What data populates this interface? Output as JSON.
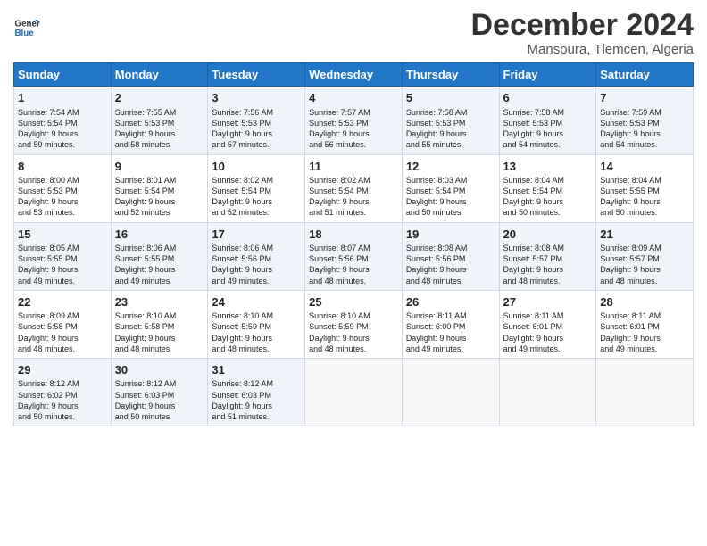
{
  "logo": {
    "line1": "General",
    "line2": "Blue"
  },
  "title": "December 2024",
  "subtitle": "Mansoura, Tlemcen, Algeria",
  "days_header": [
    "Sunday",
    "Monday",
    "Tuesday",
    "Wednesday",
    "Thursday",
    "Friday",
    "Saturday"
  ],
  "weeks": [
    [
      {
        "day": "1",
        "lines": [
          "Sunrise: 7:54 AM",
          "Sunset: 5:54 PM",
          "Daylight: 9 hours",
          "and 59 minutes."
        ]
      },
      {
        "day": "2",
        "lines": [
          "Sunrise: 7:55 AM",
          "Sunset: 5:53 PM",
          "Daylight: 9 hours",
          "and 58 minutes."
        ]
      },
      {
        "day": "3",
        "lines": [
          "Sunrise: 7:56 AM",
          "Sunset: 5:53 PM",
          "Daylight: 9 hours",
          "and 57 minutes."
        ]
      },
      {
        "day": "4",
        "lines": [
          "Sunrise: 7:57 AM",
          "Sunset: 5:53 PM",
          "Daylight: 9 hours",
          "and 56 minutes."
        ]
      },
      {
        "day": "5",
        "lines": [
          "Sunrise: 7:58 AM",
          "Sunset: 5:53 PM",
          "Daylight: 9 hours",
          "and 55 minutes."
        ]
      },
      {
        "day": "6",
        "lines": [
          "Sunrise: 7:58 AM",
          "Sunset: 5:53 PM",
          "Daylight: 9 hours",
          "and 54 minutes."
        ]
      },
      {
        "day": "7",
        "lines": [
          "Sunrise: 7:59 AM",
          "Sunset: 5:53 PM",
          "Daylight: 9 hours",
          "and 54 minutes."
        ]
      }
    ],
    [
      {
        "day": "8",
        "lines": [
          "Sunrise: 8:00 AM",
          "Sunset: 5:53 PM",
          "Daylight: 9 hours",
          "and 53 minutes."
        ]
      },
      {
        "day": "9",
        "lines": [
          "Sunrise: 8:01 AM",
          "Sunset: 5:54 PM",
          "Daylight: 9 hours",
          "and 52 minutes."
        ]
      },
      {
        "day": "10",
        "lines": [
          "Sunrise: 8:02 AM",
          "Sunset: 5:54 PM",
          "Daylight: 9 hours",
          "and 52 minutes."
        ]
      },
      {
        "day": "11",
        "lines": [
          "Sunrise: 8:02 AM",
          "Sunset: 5:54 PM",
          "Daylight: 9 hours",
          "and 51 minutes."
        ]
      },
      {
        "day": "12",
        "lines": [
          "Sunrise: 8:03 AM",
          "Sunset: 5:54 PM",
          "Daylight: 9 hours",
          "and 50 minutes."
        ]
      },
      {
        "day": "13",
        "lines": [
          "Sunrise: 8:04 AM",
          "Sunset: 5:54 PM",
          "Daylight: 9 hours",
          "and 50 minutes."
        ]
      },
      {
        "day": "14",
        "lines": [
          "Sunrise: 8:04 AM",
          "Sunset: 5:55 PM",
          "Daylight: 9 hours",
          "and 50 minutes."
        ]
      }
    ],
    [
      {
        "day": "15",
        "lines": [
          "Sunrise: 8:05 AM",
          "Sunset: 5:55 PM",
          "Daylight: 9 hours",
          "and 49 minutes."
        ]
      },
      {
        "day": "16",
        "lines": [
          "Sunrise: 8:06 AM",
          "Sunset: 5:55 PM",
          "Daylight: 9 hours",
          "and 49 minutes."
        ]
      },
      {
        "day": "17",
        "lines": [
          "Sunrise: 8:06 AM",
          "Sunset: 5:56 PM",
          "Daylight: 9 hours",
          "and 49 minutes."
        ]
      },
      {
        "day": "18",
        "lines": [
          "Sunrise: 8:07 AM",
          "Sunset: 5:56 PM",
          "Daylight: 9 hours",
          "and 48 minutes."
        ]
      },
      {
        "day": "19",
        "lines": [
          "Sunrise: 8:08 AM",
          "Sunset: 5:56 PM",
          "Daylight: 9 hours",
          "and 48 minutes."
        ]
      },
      {
        "day": "20",
        "lines": [
          "Sunrise: 8:08 AM",
          "Sunset: 5:57 PM",
          "Daylight: 9 hours",
          "and 48 minutes."
        ]
      },
      {
        "day": "21",
        "lines": [
          "Sunrise: 8:09 AM",
          "Sunset: 5:57 PM",
          "Daylight: 9 hours",
          "and 48 minutes."
        ]
      }
    ],
    [
      {
        "day": "22",
        "lines": [
          "Sunrise: 8:09 AM",
          "Sunset: 5:58 PM",
          "Daylight: 9 hours",
          "and 48 minutes."
        ]
      },
      {
        "day": "23",
        "lines": [
          "Sunrise: 8:10 AM",
          "Sunset: 5:58 PM",
          "Daylight: 9 hours",
          "and 48 minutes."
        ]
      },
      {
        "day": "24",
        "lines": [
          "Sunrise: 8:10 AM",
          "Sunset: 5:59 PM",
          "Daylight: 9 hours",
          "and 48 minutes."
        ]
      },
      {
        "day": "25",
        "lines": [
          "Sunrise: 8:10 AM",
          "Sunset: 5:59 PM",
          "Daylight: 9 hours",
          "and 48 minutes."
        ]
      },
      {
        "day": "26",
        "lines": [
          "Sunrise: 8:11 AM",
          "Sunset: 6:00 PM",
          "Daylight: 9 hours",
          "and 49 minutes."
        ]
      },
      {
        "day": "27",
        "lines": [
          "Sunrise: 8:11 AM",
          "Sunset: 6:01 PM",
          "Daylight: 9 hours",
          "and 49 minutes."
        ]
      },
      {
        "day": "28",
        "lines": [
          "Sunrise: 8:11 AM",
          "Sunset: 6:01 PM",
          "Daylight: 9 hours",
          "and 49 minutes."
        ]
      }
    ],
    [
      {
        "day": "29",
        "lines": [
          "Sunrise: 8:12 AM",
          "Sunset: 6:02 PM",
          "Daylight: 9 hours",
          "and 50 minutes."
        ]
      },
      {
        "day": "30",
        "lines": [
          "Sunrise: 8:12 AM",
          "Sunset: 6:03 PM",
          "Daylight: 9 hours",
          "and 50 minutes."
        ]
      },
      {
        "day": "31",
        "lines": [
          "Sunrise: 8:12 AM",
          "Sunset: 6:03 PM",
          "Daylight: 9 hours",
          "and 51 minutes."
        ]
      },
      null,
      null,
      null,
      null
    ]
  ]
}
